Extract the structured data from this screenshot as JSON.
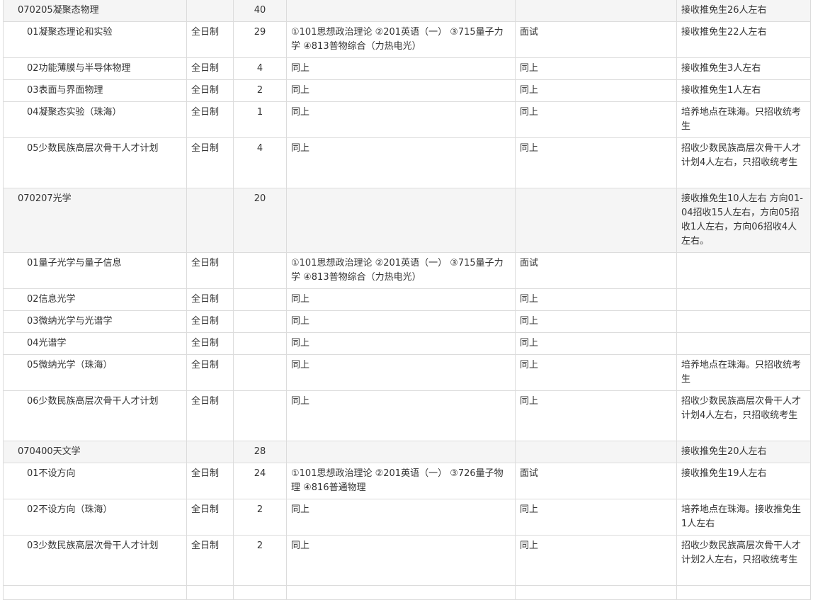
{
  "rows": [
    {
      "type": "major",
      "h": 1,
      "name": "070205凝聚态物理",
      "study": "",
      "count": "40",
      "exam": "",
      "retest": "",
      "remark": "接收推免生26人左右"
    },
    {
      "type": "sub",
      "h": 2,
      "name": "01凝聚态理论和实验",
      "study": "全日制",
      "count": "29",
      "exam": "①101思想政治理论 ②201英语（一） ③715量子力学 ④813普物综合（力热电光）",
      "retest": "面试",
      "remark": "接收推免生22人左右"
    },
    {
      "type": "sub",
      "h": 1,
      "name": "02功能薄膜与半导体物理",
      "study": "全日制",
      "count": "4",
      "exam": "同上",
      "retest": "同上",
      "remark": "接收推免生3人左右"
    },
    {
      "type": "sub",
      "h": 1,
      "name": "03表面与界面物理",
      "study": "全日制",
      "count": "2",
      "exam": "同上",
      "retest": "同上",
      "remark": "接收推免生1人左右"
    },
    {
      "type": "sub",
      "h": 2,
      "name": "04凝聚态实验（珠海）",
      "study": "全日制",
      "count": "1",
      "exam": "同上",
      "retest": "同上",
      "remark": "培养地点在珠海。只招收统考生"
    },
    {
      "type": "sub",
      "h": 3,
      "name": "05少数民族高层次骨干人才计划",
      "study": "全日制",
      "count": "4",
      "exam": "同上",
      "retest": "同上",
      "remark": "招收少数民族高层次骨干人才计划4人左右，只招收统考生"
    },
    {
      "type": "major",
      "h": 4,
      "name": "070207光学",
      "study": "",
      "count": "20",
      "exam": "",
      "retest": "",
      "remark": "接收推免生10人左右 方向01-04招收15人左右，方向05招收1人左右，方向06招收4人左右。"
    },
    {
      "type": "sub",
      "h": 2,
      "name": "01量子光学与量子信息",
      "study": "全日制",
      "count": "",
      "exam": "①101思想政治理论 ②201英语（一） ③715量子力学 ④813普物综合（力热电光）",
      "retest": "面试",
      "remark": ""
    },
    {
      "type": "sub",
      "h": 1,
      "name": "02信息光学",
      "study": "全日制",
      "count": "",
      "exam": "同上",
      "retest": "同上",
      "remark": ""
    },
    {
      "type": "sub",
      "h": 1,
      "name": "03微纳光学与光谱学",
      "study": "全日制",
      "count": "",
      "exam": "同上",
      "retest": "同上",
      "remark": ""
    },
    {
      "type": "sub",
      "h": 1,
      "name": "04光谱学",
      "study": "全日制",
      "count": "",
      "exam": "同上",
      "retest": "同上",
      "remark": ""
    },
    {
      "type": "sub",
      "h": 2,
      "name": "05微纳光学（珠海）",
      "study": "全日制",
      "count": "",
      "exam": "同上",
      "retest": "同上",
      "remark": "培养地点在珠海。只招收统考生"
    },
    {
      "type": "sub",
      "h": 3,
      "name": "06少数民族高层次骨干人才计划",
      "study": "全日制",
      "count": "",
      "exam": "同上",
      "retest": "同上",
      "remark": "招收少数民族高层次骨干人才计划4人左右，只招收统考生"
    },
    {
      "type": "major",
      "h": 1,
      "name": "070400天文学",
      "study": "",
      "count": "28",
      "exam": "",
      "retest": "",
      "remark": "接收推免生20人左右"
    },
    {
      "type": "sub",
      "h": 2,
      "name": "01不设方向",
      "study": "全日制",
      "count": "24",
      "exam": "①101思想政治理论 ②201英语（一） ③726量子物理 ④816普通物理",
      "retest": "面试",
      "remark": "接收推免生19人左右"
    },
    {
      "type": "sub",
      "h": 2,
      "name": "02不设方向（珠海）",
      "study": "全日制",
      "count": "2",
      "exam": "同上",
      "retest": "同上",
      "remark": "培养地点在珠海。接收推免生1人左右"
    },
    {
      "type": "sub",
      "h": 3,
      "name": "03少数民族高层次骨干人才计划",
      "study": "全日制",
      "count": "2",
      "exam": "同上",
      "retest": "同上",
      "remark": "招收少数民族高层次骨干人才计划2人左右，只招收统考生"
    },
    {
      "type": "stub",
      "h": 0,
      "name": "",
      "study": "",
      "count": "",
      "exam": "",
      "retest": "",
      "remark": ""
    }
  ]
}
